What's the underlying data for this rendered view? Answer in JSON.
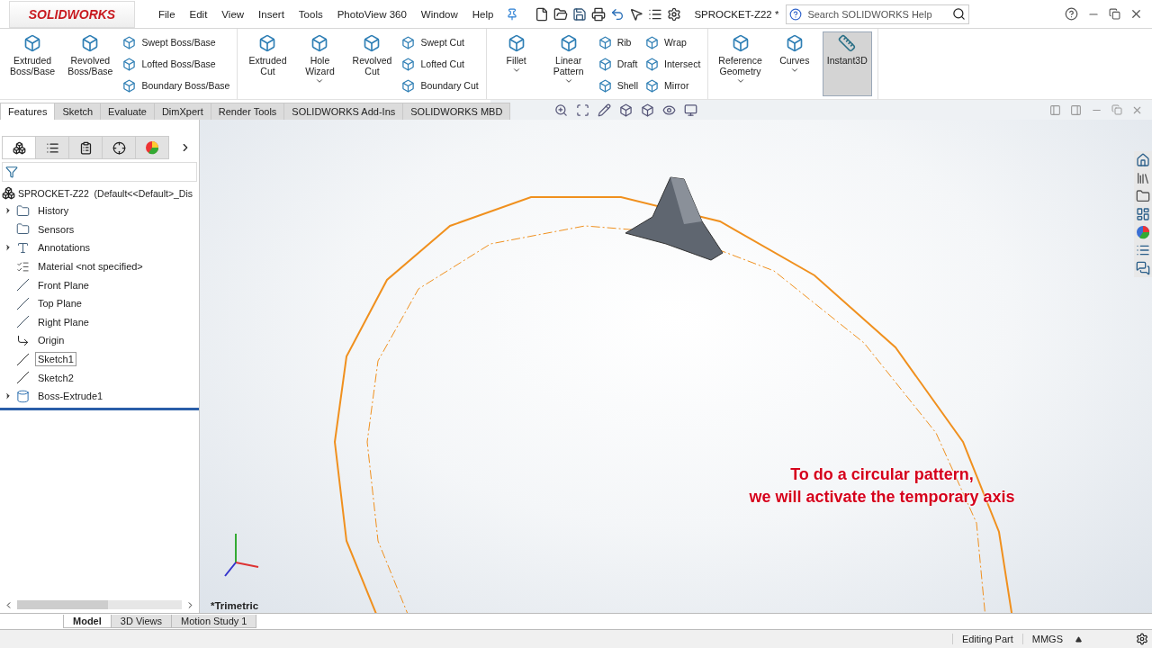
{
  "logo": "SOLIDWORKS",
  "menu": [
    "File",
    "Edit",
    "View",
    "Insert",
    "Tools",
    "PhotoView 360",
    "Window",
    "Help"
  ],
  "document_title": "SPROCKET-Z22 *",
  "search": {
    "placeholder": "Search SOLIDWORKS Help"
  },
  "ribbon": [
    {
      "items": [
        {
          "kind": "large",
          "label": "Extruded\nBoss/Base",
          "dropdown": false,
          "selected": false
        },
        {
          "kind": "large",
          "label": "Revolved\nBoss/Base",
          "dropdown": false,
          "selected": false
        },
        {
          "kind": "stack",
          "items": [
            "Swept Boss/Base",
            "Lofted Boss/Base",
            "Boundary Boss/Base"
          ]
        }
      ]
    },
    {
      "items": [
        {
          "kind": "large",
          "label": "Extruded\nCut",
          "dropdown": false,
          "selected": false
        },
        {
          "kind": "large",
          "label": "Hole\nWizard",
          "dropdown": true,
          "selected": false
        },
        {
          "kind": "large",
          "label": "Revolved\nCut",
          "dropdown": false,
          "selected": false
        },
        {
          "kind": "stack",
          "items": [
            "Swept Cut",
            "Lofted Cut",
            "Boundary Cut"
          ]
        }
      ]
    },
    {
      "items": [
        {
          "kind": "large",
          "label": "Fillet",
          "dropdown": true,
          "selected": false
        },
        {
          "kind": "large",
          "label": "Linear\nPattern",
          "dropdown": true,
          "selected": false
        },
        {
          "kind": "stack",
          "items": [
            "Rib",
            "Draft",
            "Shell"
          ]
        },
        {
          "kind": "stack",
          "items": [
            "Wrap",
            "Intersect",
            "Mirror"
          ]
        }
      ]
    },
    {
      "items": [
        {
          "kind": "large",
          "label": "Reference\nGeometry",
          "dropdown": true,
          "selected": false
        },
        {
          "kind": "large",
          "label": "Curves",
          "dropdown": true,
          "selected": false
        },
        {
          "kind": "large",
          "label": "Instant3D",
          "dropdown": false,
          "selected": true
        }
      ]
    }
  ],
  "tabs": [
    {
      "label": "Features",
      "selected": true
    },
    {
      "label": "Sketch",
      "selected": false
    },
    {
      "label": "Evaluate",
      "selected": false
    },
    {
      "label": "DimXpert",
      "selected": false
    },
    {
      "label": "Render Tools",
      "selected": false
    },
    {
      "label": "SOLIDWORKS Add-Ins",
      "selected": false
    },
    {
      "label": "SOLIDWORKS MBD",
      "selected": false
    }
  ],
  "manager_tabs": [
    {
      "selected": true
    },
    {
      "selected": false
    },
    {
      "selected": false
    },
    {
      "selected": false
    },
    {
      "selected": false
    }
  ],
  "tree": {
    "label": "SPROCKET-Z22  (Default<<Default>_Dis",
    "children": [
      {
        "label": "History",
        "kind": "folder",
        "expandable": true,
        "selected": false
      },
      {
        "label": "Sensors",
        "kind": "folder",
        "expandable": false,
        "selected": false
      },
      {
        "label": "Annotations",
        "kind": "annotation",
        "expandable": true,
        "selected": false
      },
      {
        "label": "Material <not specified>",
        "kind": "material",
        "expandable": false,
        "selected": false
      },
      {
        "label": "Front Plane",
        "kind": "plane",
        "expandable": false,
        "selected": false
      },
      {
        "label": "Top Plane",
        "kind": "plane",
        "expandable": false,
        "selected": false
      },
      {
        "label": "Right Plane",
        "kind": "plane",
        "expandable": false,
        "selected": false
      },
      {
        "label": "Origin",
        "kind": "origin",
        "expandable": false,
        "selected": false
      },
      {
        "label": "Sketch1",
        "kind": "sketch",
        "expandable": false,
        "selected": true
      },
      {
        "label": "Sketch2",
        "kind": "sketch",
        "expandable": false,
        "selected": false
      },
      {
        "label": "Boss-Extrude1",
        "kind": "feature",
        "expandable": true,
        "selected": false
      }
    ]
  },
  "viewport": {
    "view_name": "*Trimetric",
    "caption": "To do a circular pattern,\nwe will activate the temporary axis"
  },
  "bottom_tabs": [
    {
      "label": "Model",
      "selected": true
    },
    {
      "label": "3D Views",
      "selected": false
    },
    {
      "label": "Motion Study 1",
      "selected": false
    }
  ],
  "status_bar": [
    "Editing Part",
    "MMGS"
  ]
}
